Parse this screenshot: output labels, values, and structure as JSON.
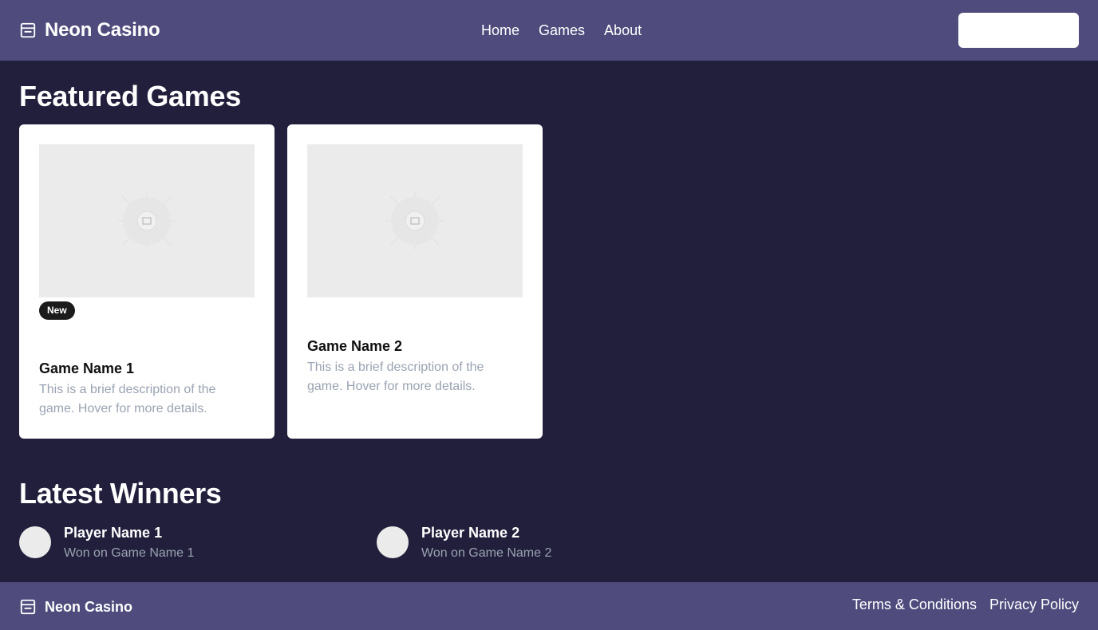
{
  "header": {
    "brand": "Neon Casino",
    "brand_icon": "inbox-icon",
    "nav": [
      {
        "label": "Home"
      },
      {
        "label": "Games"
      },
      {
        "label": "About"
      }
    ],
    "action_button_label": ""
  },
  "featured": {
    "title": "Featured Games",
    "games": [
      {
        "name": "Game Name 1",
        "description": "This is a brief description of the game. Hover for more details.",
        "badge": "New",
        "image_icon": "image-placeholder-icon"
      },
      {
        "name": "Game Name 2",
        "description": "This is a brief description of the game. Hover for more details.",
        "badge": "",
        "image_icon": "image-placeholder-icon"
      }
    ]
  },
  "winners": {
    "title": "Latest Winners",
    "items": [
      {
        "name": "Player Name 1",
        "detail": "Won on Game Name 1"
      },
      {
        "name": "Player Name 2",
        "detail": "Won on Game Name 2"
      }
    ]
  },
  "footer": {
    "brand": "Neon Casino",
    "links": [
      {
        "label": "Terms & Conditions"
      },
      {
        "label": "Privacy Policy"
      }
    ]
  },
  "colors": {
    "background": "#221f3c",
    "header": "#4f4c7d",
    "card": "#ffffff",
    "muted_text": "#9aa3b2",
    "badge": "#1b1b1b"
  }
}
